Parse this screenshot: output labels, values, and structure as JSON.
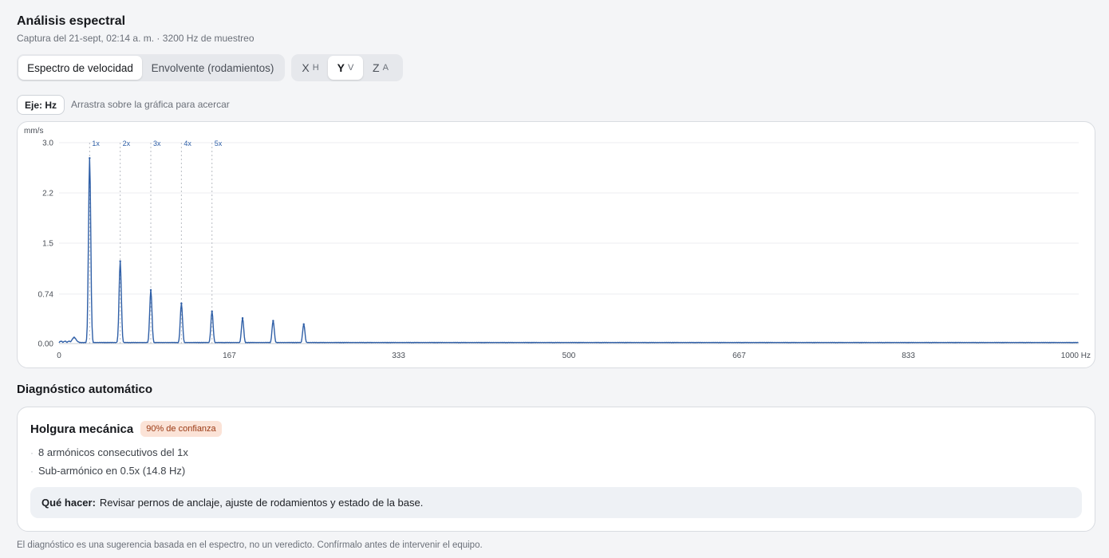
{
  "header": {
    "title": "Análisis espectral",
    "subtitle": "Captura del 21-sept, 02:14 a. m. · 3200 Hz de muestreo"
  },
  "mode_tabs": [
    {
      "label": "Espectro de velocidad",
      "active": true
    },
    {
      "label": "Envolvente (rodamientos)",
      "active": false
    }
  ],
  "axis_tabs": [
    {
      "letter": "X",
      "sub": "H",
      "active": false
    },
    {
      "letter": "Y",
      "sub": "V",
      "active": true
    },
    {
      "letter": "Z",
      "sub": "A",
      "active": false
    }
  ],
  "toolbar": {
    "unit_chip": "Eje: Hz",
    "hint": "Arrastra sobre la gráfica para acercar"
  },
  "chart_data": {
    "type": "line",
    "ylabel": "mm/s",
    "x_unit": "Hz",
    "xlim": [
      0,
      1000
    ],
    "ylim": [
      0,
      3.0
    ],
    "y_ticks": [
      "3.0",
      "2.2",
      "1.5",
      "0.74",
      "0.00"
    ],
    "y_tick_values": [
      3.0,
      2.25,
      1.5,
      0.74,
      0.0
    ],
    "x_ticks": [
      "0",
      "167",
      "333",
      "500",
      "667",
      "833",
      "1000 Hz"
    ],
    "x_tick_values": [
      0,
      167,
      333,
      500,
      667,
      833,
      1000
    ],
    "grid": true,
    "harmonic_markers": [
      {
        "label": "1x",
        "x": 30
      },
      {
        "label": "2x",
        "x": 60
      },
      {
        "label": "3x",
        "x": 90
      },
      {
        "label": "4x",
        "x": 120
      },
      {
        "label": "5x",
        "x": 150
      }
    ],
    "peaks": [
      {
        "x": 14.8,
        "y": 0.09
      },
      {
        "x": 30,
        "y": 2.77
      },
      {
        "x": 60,
        "y": 1.23
      },
      {
        "x": 90,
        "y": 0.8
      },
      {
        "x": 120,
        "y": 0.6
      },
      {
        "x": 150,
        "y": 0.48
      },
      {
        "x": 180,
        "y": 0.38
      },
      {
        "x": 210,
        "y": 0.34
      },
      {
        "x": 240,
        "y": 0.29
      }
    ],
    "line_color": "#2f5fa7"
  },
  "diagnosis": {
    "section_title": "Diagnóstico automático",
    "title": "Holgura mecánica",
    "confidence": "90% de confianza",
    "evidence": [
      "8 armónicos consecutivos del 1x",
      "Sub-armónico en 0.5x (14.8 Hz)"
    ],
    "action_label": "Qué hacer:",
    "action_text": "Revisar pernos de anclaje, ajuste de rodamientos y estado de la base."
  },
  "footnote": "El diagnóstico es una sugerencia basada en el espectro, no un veredicto. Confírmalo antes de intervenir el equipo."
}
